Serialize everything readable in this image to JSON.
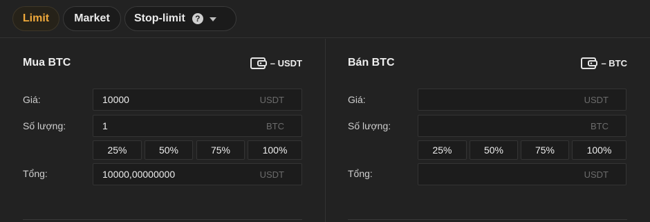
{
  "tabs": [
    {
      "label": "Limit"
    },
    {
      "label": "Market"
    },
    {
      "label": "Stop-limit"
    }
  ],
  "help_glyph": "?",
  "buy": {
    "title": "Mua BTC",
    "wallet_label": "– USDT",
    "price_label": "Giá:",
    "price_value": "10000",
    "price_unit": "USDT",
    "amount_label": "Số lượng:",
    "amount_value": "1",
    "amount_unit": "BTC",
    "percents": [
      "25%",
      "50%",
      "75%",
      "100%"
    ],
    "total_label": "Tổng:",
    "total_value": "10000,00000000",
    "total_unit": "USDT"
  },
  "sell": {
    "title": "Bán BTC",
    "wallet_label": "– BTC",
    "price_label": "Giá:",
    "price_value": "",
    "price_unit": "USDT",
    "amount_label": "Số lượng:",
    "amount_value": "",
    "amount_unit": "BTC",
    "percents": [
      "25%",
      "50%",
      "75%",
      "100%"
    ],
    "total_label": "Tổng:",
    "total_value": "",
    "total_unit": "USDT"
  },
  "colors": {
    "accent": "#f0a93b",
    "background": "#222222",
    "field": "#1c1c1c"
  }
}
